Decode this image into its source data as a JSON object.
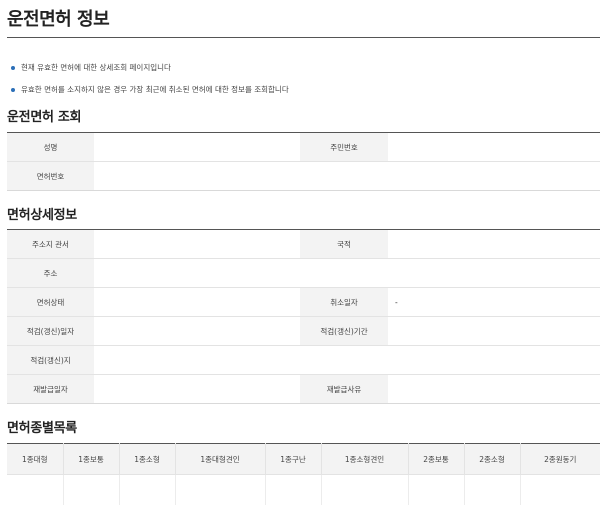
{
  "page": {
    "title": "운전면허 정보",
    "notes": [
      "현재 유효한 면허에 대한 상세조회 페이지입니다",
      "유효한 면허를 소지하지 않은 경우 가장 최근에 취소된 면허에 대한 정보를 조회합니다"
    ]
  },
  "lookup": {
    "title": "운전면허 조회",
    "name_label": "성명",
    "name_value": "",
    "resident_no_label": "주민번호",
    "resident_no_value": "",
    "license_no_label": "면허번호",
    "license_no_value": ""
  },
  "detail": {
    "title": "면허상세정보",
    "jurisdiction_label": "주소지 관서",
    "jurisdiction_value": "",
    "nationality_label": "국적",
    "nationality_value": "",
    "address_label": "주소",
    "address_value": "",
    "status_label": "면허상태",
    "status_value": "",
    "cancel_date_label": "취소일자",
    "cancel_date_value": "-",
    "test_date_label": "적검(갱신)일자",
    "test_date_value": "",
    "test_period_label": "적검(갱신)기간",
    "test_period_value": "",
    "test_place_label": "적검(갱신)지",
    "test_place_value": "",
    "reissue_date_label": "재발급일자",
    "reissue_date_value": "",
    "reissue_reason_label": "재발급사유",
    "reissue_reason_value": ""
  },
  "types": {
    "title": "면허종별목록",
    "columns": [
      "1종대형",
      "1종보통",
      "1종소형",
      "1종대형견인",
      "1종구난",
      "1종소형견인",
      "2종보통",
      "2종소형",
      "2종원동기"
    ]
  }
}
